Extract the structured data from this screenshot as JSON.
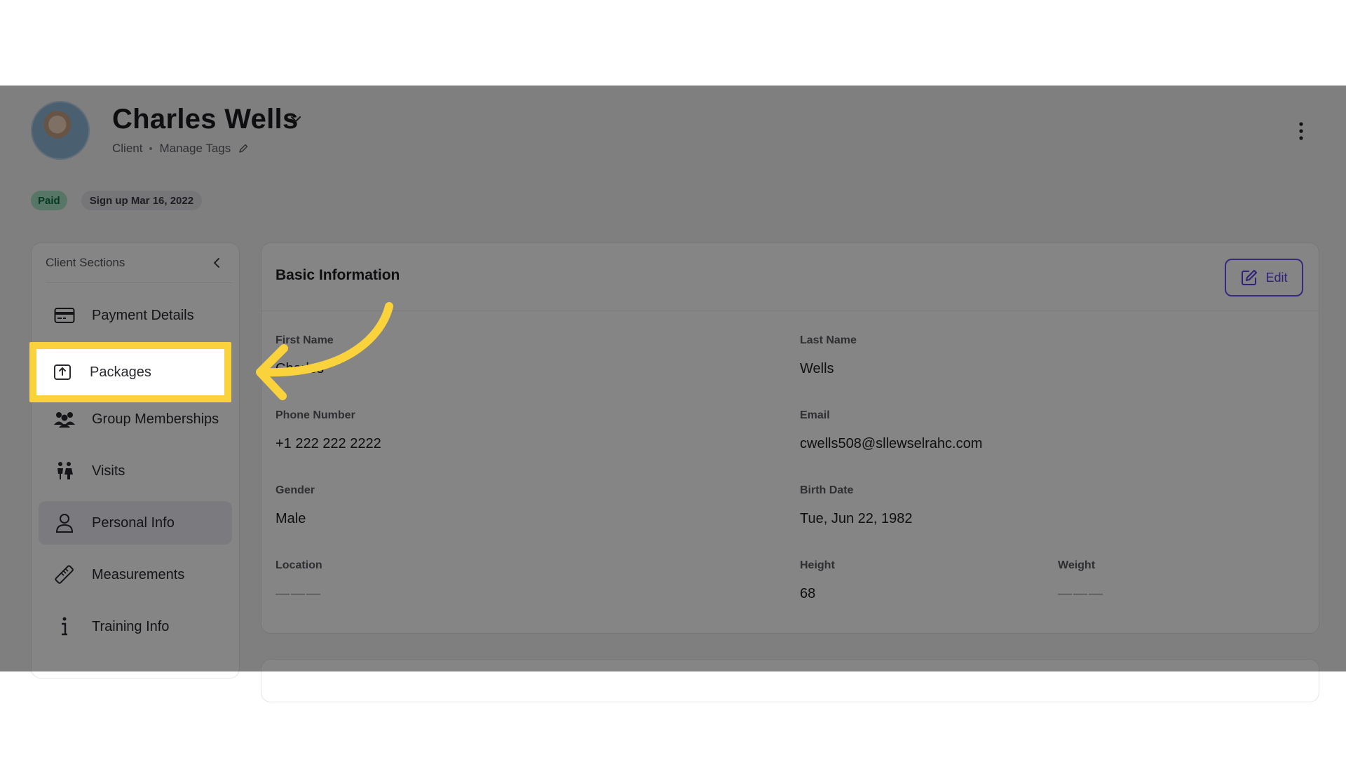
{
  "client": {
    "name": "Charles Wells",
    "role": "Client",
    "manage_tags": "Manage Tags"
  },
  "badges": {
    "paid": "Paid",
    "signup": "Sign up Mar 16, 2022"
  },
  "sidebar": {
    "title": "Client Sections",
    "items": [
      {
        "label": "Payment Details",
        "icon": "credit-card-icon"
      },
      {
        "label": "Packages",
        "icon": "package-icon"
      },
      {
        "label": "Group Memberships",
        "icon": "group-icon"
      },
      {
        "label": "Visits",
        "icon": "visits-icon"
      },
      {
        "label": "Personal Info",
        "icon": "person-icon",
        "active": true
      },
      {
        "label": "Measurements",
        "icon": "ruler-icon"
      },
      {
        "label": "Training Info",
        "icon": "info-icon"
      }
    ]
  },
  "basic_info": {
    "title": "Basic Information",
    "edit_label": "Edit",
    "first_name_label": "First Name",
    "first_name_value": "Charles",
    "last_name_label": "Last Name",
    "last_name_value": "Wells",
    "phone_label": "Phone Number",
    "phone_value": "+1 222 222 2222",
    "email_label": "Email",
    "email_value": "cwells508@sllewselrahc.com",
    "gender_label": "Gender",
    "gender_value": "Male",
    "birth_label": "Birth Date",
    "birth_value": "Tue, Jun 22, 1982",
    "location_label": "Location",
    "location_value": "———",
    "height_label": "Height",
    "height_value": "68",
    "weight_label": "Weight",
    "weight_value": "———"
  },
  "colors": {
    "accent": "#5b3fe6",
    "highlight": "#f9d23c",
    "paid_badge": "#a9e2c6"
  }
}
